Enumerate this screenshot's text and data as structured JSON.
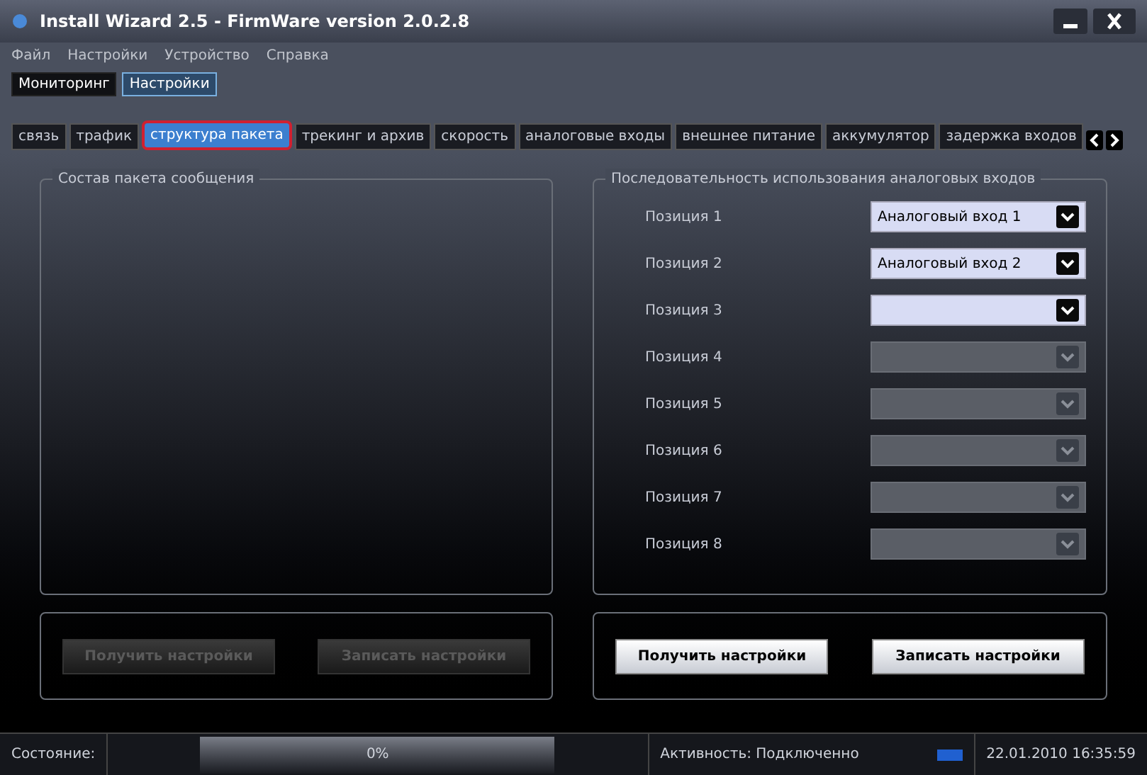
{
  "window": {
    "title": "Install Wizard 2.5 - FirmWare version 2.0.2.8"
  },
  "menu": [
    "Файл",
    "Настройки",
    "Устройство",
    "Справка"
  ],
  "modes": [
    {
      "label": "Мониторинг",
      "selected": false
    },
    {
      "label": "Настройки",
      "selected": true
    }
  ],
  "tabs": [
    {
      "label": "связь",
      "selected": false
    },
    {
      "label": "трафик",
      "selected": false
    },
    {
      "label": "структура пакета",
      "selected": true
    },
    {
      "label": "трекинг и архив",
      "selected": false
    },
    {
      "label": "скорость",
      "selected": false
    },
    {
      "label": "аналоговые входы",
      "selected": false
    },
    {
      "label": "внешнее питание",
      "selected": false
    },
    {
      "label": "аккумулятор",
      "selected": false
    },
    {
      "label": "задержка входов",
      "selected": false
    }
  ],
  "left_panel": {
    "title": "Состав пакета сообщения",
    "buttons": [
      {
        "label": "Получить настройки",
        "disabled": true
      },
      {
        "label": "Записать настройки",
        "disabled": true
      }
    ]
  },
  "right_panel": {
    "title": "Последовательность использования аналоговых входов",
    "positions": [
      {
        "label": "Позиция 1",
        "value": "Аналоговый вход 1",
        "disabled": false
      },
      {
        "label": "Позиция 2",
        "value": "Аналоговый вход 2",
        "disabled": false
      },
      {
        "label": "Позиция 3",
        "disabled": false
      },
      {
        "label": "Позиция 4",
        "disabled": true
      },
      {
        "label": "Позиция 5",
        "disabled": true
      },
      {
        "label": "Позиция 6",
        "disabled": true
      },
      {
        "label": "Позиция 7",
        "disabled": true
      },
      {
        "label": "Позиция 8",
        "disabled": true
      }
    ],
    "buttons": [
      {
        "label": "Получить настройки",
        "disabled": false
      },
      {
        "label": "Записать настройки",
        "disabled": false
      }
    ]
  },
  "status_bar": {
    "label": "Состояние:",
    "progress": {
      "level": 0,
      "reading": "0%"
    },
    "activity": "Активность: Подключенно",
    "datetime": "22.01.2010 16:35:59"
  }
}
